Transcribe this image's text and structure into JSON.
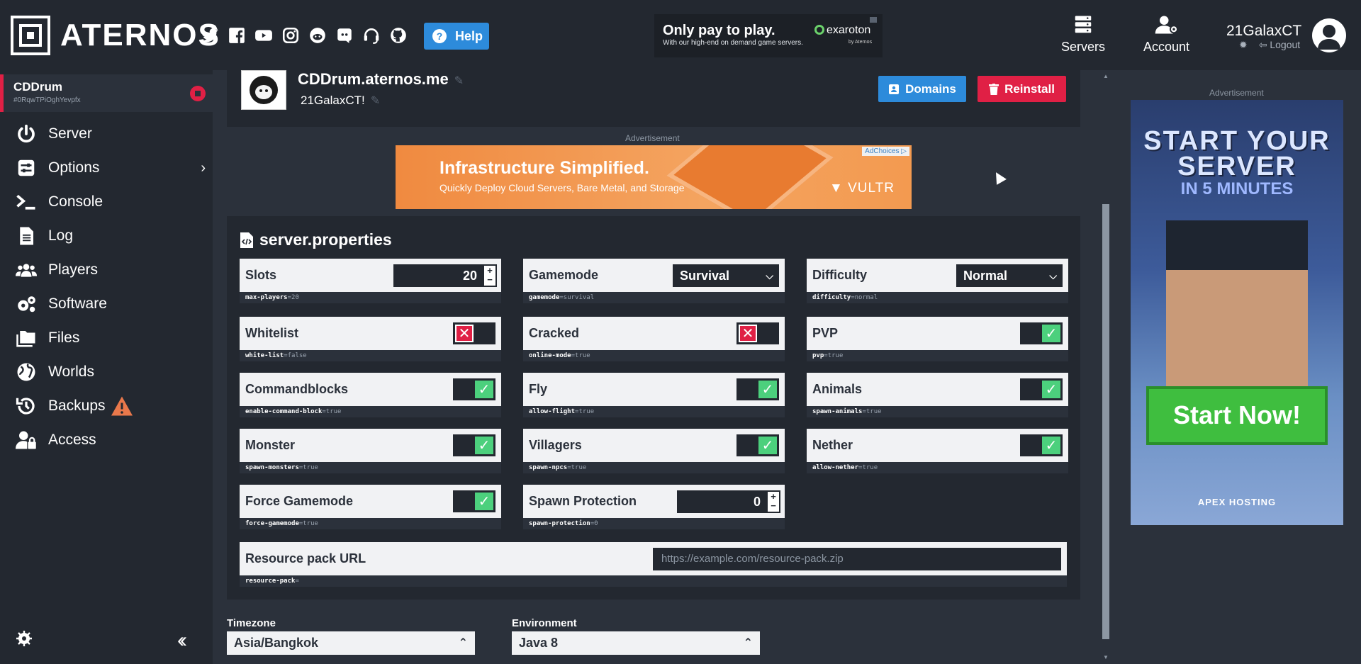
{
  "header": {
    "logo_text": "ATERNOS",
    "help_label": "Help",
    "socials": [
      "twitter-icon",
      "facebook-icon",
      "youtube-icon",
      "instagram-icon",
      "reddit-icon",
      "discord-icon",
      "support-icon",
      "github-icon"
    ],
    "top_ad": {
      "headline": "Only pay to play.",
      "sub": "With our high-end on demand game servers.",
      "brand": "exaroton",
      "brand_sub": "by Aternos"
    },
    "nav": [
      {
        "label": "Servers",
        "icon": "servers-icon"
      },
      {
        "label": "Account",
        "icon": "account-icon"
      }
    ],
    "user": {
      "name": "21GalaxCT",
      "logout": "Logout"
    }
  },
  "sidebar": {
    "server": {
      "name": "CDDrum",
      "id": "#0RqwTPiOghYevpfx"
    },
    "items": [
      {
        "label": "Server",
        "icon": "power-icon"
      },
      {
        "label": "Options",
        "icon": "sliders-icon"
      },
      {
        "label": "Console",
        "icon": "terminal-icon"
      },
      {
        "label": "Log",
        "icon": "file-icon"
      },
      {
        "label": "Players",
        "icon": "users-icon"
      },
      {
        "label": "Software",
        "icon": "gears-icon"
      },
      {
        "label": "Files",
        "icon": "folder-icon"
      },
      {
        "label": "Worlds",
        "icon": "globe-icon"
      },
      {
        "label": "Backups",
        "icon": "history-icon"
      },
      {
        "label": "Access",
        "icon": "user-lock-icon"
      }
    ]
  },
  "server_panel": {
    "address": "CDDrum.aternos.me",
    "motd": "21GalaxCT!",
    "domains_label": "Domains",
    "reinstall_label": "Reinstall"
  },
  "ads": {
    "label": "Advertisement",
    "mid": {
      "headline": "Infrastructure Simplified.",
      "sub": "Quickly Deploy Cloud Servers, Bare Metal, and Storage",
      "brand": "VULTR",
      "adchoices": "AdChoices"
    },
    "side": {
      "line1": "START YOUR SERVER",
      "line2": "IN 5 MINUTES",
      "cta": "Start Now!",
      "brand": "APEX HOSTING"
    }
  },
  "properties": {
    "title": "server.properties",
    "items": {
      "slots": {
        "label": "Slots",
        "key": "max-players",
        "val": "20",
        "value": "20"
      },
      "gamemode": {
        "label": "Gamemode",
        "key": "gamemode",
        "val": "survival",
        "value": "Survival"
      },
      "difficulty": {
        "label": "Difficulty",
        "key": "difficulty",
        "val": "normal",
        "value": "Normal"
      },
      "whitelist": {
        "label": "Whitelist",
        "key": "white-list",
        "val": "false",
        "on": false
      },
      "cracked": {
        "label": "Cracked",
        "key": "online-mode",
        "val": "true",
        "on": false
      },
      "pvp": {
        "label": "PVP",
        "key": "pvp",
        "val": "true",
        "on": true
      },
      "commandblocks": {
        "label": "Commandblocks",
        "key": "enable-command-block",
        "val": "true",
        "on": true
      },
      "fly": {
        "label": "Fly",
        "key": "allow-flight",
        "val": "true",
        "on": true
      },
      "animals": {
        "label": "Animals",
        "key": "spawn-animals",
        "val": "true",
        "on": true
      },
      "monster": {
        "label": "Monster",
        "key": "spawn-monsters",
        "val": "true",
        "on": true
      },
      "villagers": {
        "label": "Villagers",
        "key": "spawn-npcs",
        "val": "true",
        "on": true
      },
      "nether": {
        "label": "Nether",
        "key": "allow-nether",
        "val": "true",
        "on": true
      },
      "force_gamemode": {
        "label": "Force Gamemode",
        "key": "force-gamemode",
        "val": "true",
        "on": true
      },
      "spawn_protection": {
        "label": "Spawn Protection",
        "key": "spawn-protection",
        "val": "0",
        "value": "0"
      },
      "resource_pack": {
        "label": "Resource pack URL",
        "key": "resource-pack",
        "val": "",
        "placeholder": "https://example.com/resource-pack.zip"
      }
    }
  },
  "bottom": {
    "timezone_label": "Timezone",
    "timezone_value": "Asia/Bangkok",
    "environment_label": "Environment",
    "environment_value": "Java 8"
  }
}
